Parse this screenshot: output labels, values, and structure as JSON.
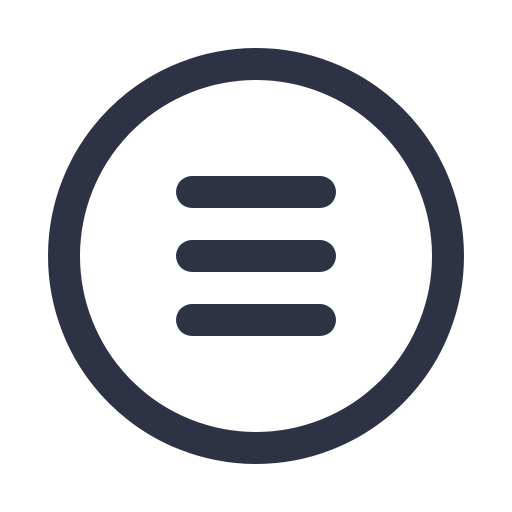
{
  "icon": {
    "name": "menu-circle-icon",
    "stroke_color": "#2d3345",
    "background_color": "#ffffff"
  }
}
